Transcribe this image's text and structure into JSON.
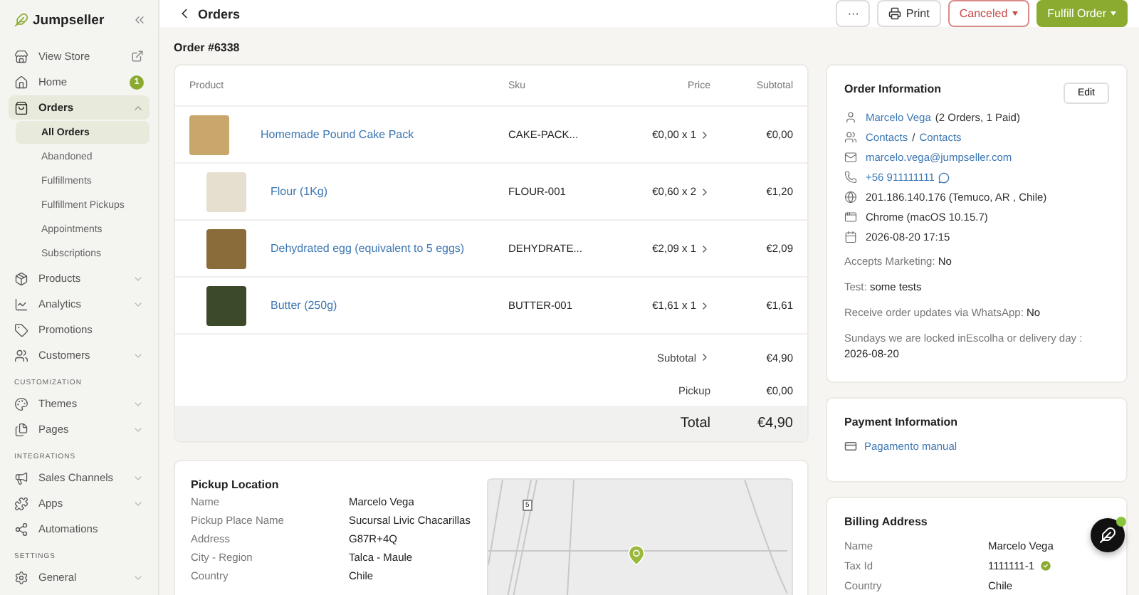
{
  "sidebar": {
    "brand": "Jumpseller",
    "items": [
      {
        "kind": "item",
        "label": "View Store",
        "external": true
      },
      {
        "kind": "item",
        "label": "Home",
        "badge": "1"
      },
      {
        "kind": "item",
        "label": "Orders",
        "selected": true,
        "expanded": true,
        "children": [
          {
            "label": "All Orders",
            "selected": true
          },
          {
            "label": "Abandoned",
            "selected": false
          },
          {
            "label": "Fulfillments",
            "selected": false
          },
          {
            "label": "Fulfillment Pickups",
            "selected": false
          },
          {
            "label": "Appointments",
            "selected": false
          },
          {
            "label": "Subscriptions",
            "selected": false
          }
        ]
      },
      {
        "kind": "item",
        "label": "Products",
        "selected": false,
        "expanded": false
      },
      {
        "kind": "item",
        "label": "Analytics",
        "selected": false,
        "expanded": false
      },
      {
        "kind": "item",
        "label": "Promotions",
        "selected": false
      },
      {
        "kind": "item",
        "label": "Customers",
        "selected": false,
        "expanded": false
      },
      {
        "kind": "section",
        "label": "CUSTOMIZATION"
      },
      {
        "kind": "item",
        "label": "Themes",
        "selected": false,
        "expanded": false
      },
      {
        "kind": "item",
        "label": "Pages",
        "selected": false,
        "expanded": false
      },
      {
        "kind": "section",
        "label": "INTEGRATIONS"
      },
      {
        "kind": "item",
        "label": "Sales Channels",
        "selected": false,
        "expanded": false
      },
      {
        "kind": "item",
        "label": "Apps",
        "selected": false,
        "expanded": false
      },
      {
        "kind": "item",
        "label": "Automations",
        "selected": false
      },
      {
        "kind": "section",
        "label": "SETTINGS"
      },
      {
        "kind": "item",
        "label": "General",
        "selected": false,
        "expanded": false
      }
    ]
  },
  "header": {
    "back_label": "Orders",
    "more_label": "···",
    "print_label": "Print",
    "status_label": "Canceled",
    "fulfill_label": "Fulfill Order"
  },
  "order_title": "Order #6338",
  "products": {
    "columns": [
      "Product",
      "Sku",
      "Price",
      "Subtotal"
    ],
    "rows": [
      {
        "name": "Homemade Pound Cake Pack",
        "sku": "CAKE-PACK...",
        "price": "€0,00 x 1",
        "subtotal": "€0,00",
        "indented": false
      },
      {
        "name": "Flour (1Kg)",
        "sku": "FLOUR-001",
        "price": "€0,60 x 2",
        "subtotal": "€1,20",
        "indented": true
      },
      {
        "name": "Dehydrated egg (equivalent to 5 eggs)",
        "sku": "DEHYDRATE...",
        "price": "€2,09 x 1",
        "subtotal": "€2,09",
        "indented": true
      },
      {
        "name": "Butter (250g)",
        "sku": "BUTTER-001",
        "price": "€1,61 x 1",
        "subtotal": "€1,61",
        "indented": true
      }
    ],
    "summary": [
      {
        "label": "Subtotal",
        "value": "€4,90",
        "chevron": true
      },
      {
        "label": "Pickup",
        "value": "€0,00",
        "chevron": false
      }
    ],
    "total": {
      "label": "Total",
      "value": "€4,90"
    }
  },
  "pickup": {
    "title": "Pickup Location",
    "fields": [
      {
        "label": "Name",
        "value": "Marcelo Vega"
      },
      {
        "label": "Pickup Place Name",
        "value": "Sucursal Livic Chacarillas"
      },
      {
        "label": "Address",
        "value": "G87R+4Q"
      },
      {
        "label": "City - Region",
        "value": "Talca - Maule"
      },
      {
        "label": "Country",
        "value": "Chile"
      }
    ],
    "map_road_label": "5"
  },
  "order_info": {
    "title": "Order Information",
    "edit_label": "Edit",
    "lines": [
      {
        "kind": "customer",
        "link": "Marcelo Vega",
        "note": "(2 Orders, 1 Paid)"
      },
      {
        "kind": "contacts",
        "links": [
          "Contacts",
          "Contacts"
        ],
        "separator": "/"
      },
      {
        "kind": "email",
        "link": "marcelo.vega@jumpseller.com"
      },
      {
        "kind": "phone",
        "link": "+56 911111111"
      },
      {
        "kind": "ip",
        "text": "201.186.140.176 (Temuco, AR , Chile)"
      },
      {
        "kind": "browser",
        "text": "Chrome (macOS 10.15.7)"
      },
      {
        "kind": "date",
        "text": "2026-08-20 17:15"
      }
    ],
    "attributes": [
      {
        "label": "Accepts Marketing:",
        "value": "No"
      },
      {
        "label": "Test:",
        "value": "some tests"
      },
      {
        "label": "Receive order updates via WhatsApp:",
        "value": "No"
      },
      {
        "label": "Sundays we are locked inEscolha or delivery day :",
        "value": "2026-08-20"
      }
    ]
  },
  "payment": {
    "title": "Payment Information",
    "method": "Pagamento manual"
  },
  "billing": {
    "title": "Billing Address",
    "fields": [
      {
        "label": "Name",
        "value": "Marcelo Vega",
        "verified": false
      },
      {
        "label": "Tax Id",
        "value": "1111111-1",
        "verified": true
      },
      {
        "label": "Country",
        "value": "Chile",
        "verified": false
      }
    ]
  }
}
